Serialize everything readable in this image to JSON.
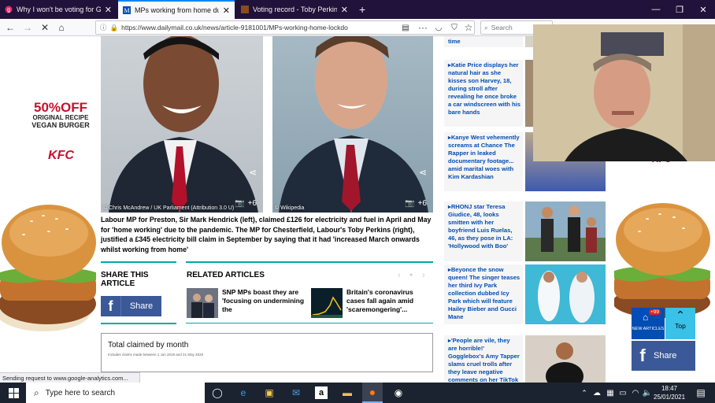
{
  "browser": {
    "tabs": [
      {
        "title": "Why I won't be voting for Gov",
        "active": false
      },
      {
        "title": "MPs working from home durin",
        "active": true
      },
      {
        "title": "Voting record - Toby Perkins M",
        "active": false
      }
    ],
    "new_tab": "+",
    "url": "https://www.dailymail.co.uk/news/article-9181001/MPs-working-home-lockdo",
    "search_placeholder": "Search",
    "status": "Sending request to www.google-analytics.com..."
  },
  "ads": {
    "offer_headline": "50%OFF",
    "offer_sub1": "ORIGINAL RECIPE",
    "offer_sub2": "VEGAN BURGER",
    "brand": "KFC"
  },
  "article": {
    "photo_left_credit": "© Chris McAndrew / UK Parliament (Attribution 3.0 U)",
    "photo_right_credit": "© Wikipedia",
    "photo_count": "+6",
    "caption": "Labour MP for Preston, Sir Mark Hendrick (left), claimed £126 for electricity and fuel in April and May for 'home working' due to the pandemic. The MP for Chesterfield, Labour's Toby Perkins (right), justified a £345 electricity bill claim in September by saying that it had 'increased March onwards whilst working from home'",
    "share_heading": "SHARE THIS ARTICLE",
    "share_button": "Share",
    "related_heading": "RELATED ARTICLES",
    "related": [
      {
        "title": "SNP MPs boast they are 'focusing on undermining the"
      },
      {
        "title": "Britain's coronavirus cases fall again amid 'scaremongering'..."
      }
    ],
    "chart_box_title": "Total claimed by month",
    "chart_box_sub": "Includes claims made between 1 Jun 2019 and 31 May 2020"
  },
  "sidebar": {
    "items": [
      {
        "text": "time"
      },
      {
        "text": "Katie Price displays her natural hair as she kisses son Harvey, 18, during stroll after revealing he once broke a car windscreen with his bare hands"
      },
      {
        "text": "Kanye West vehemently screams at Chance The Rapper in leaked documentary footage... amid marital woes with Kim Kardashian"
      },
      {
        "text": "RHONJ star Teresa Giudice, 48, looks smitten with her boyfriend Luis Ruelas, 46, as they pose in LA: 'Hollywood with Boo'"
      },
      {
        "text": "Beyonce the snow queen! The singer teases her third Ivy Park collection dubbed Icy Park which will feature Hailey Bieber and Gucci Mane"
      },
      {
        "text": "'People are vile, they are horrible!' Gogglebox's Amy Tapper slams cruel trolls after they leave negative comments on her TikTok"
      }
    ],
    "new_articles_count": "+99",
    "new_articles_label": "NEW ARTICLES",
    "top_label": "Top",
    "share_button": "Share"
  },
  "taskbar": {
    "search_placeholder": "Type here to search",
    "time": "18:47",
    "date": "25/01/2021"
  },
  "colors": {
    "tabstrip": "#20123a",
    "facebook": "#3b5998",
    "link_blue": "#004db3",
    "kfc_red": "#c8102e",
    "teal": "#00aaa8"
  }
}
